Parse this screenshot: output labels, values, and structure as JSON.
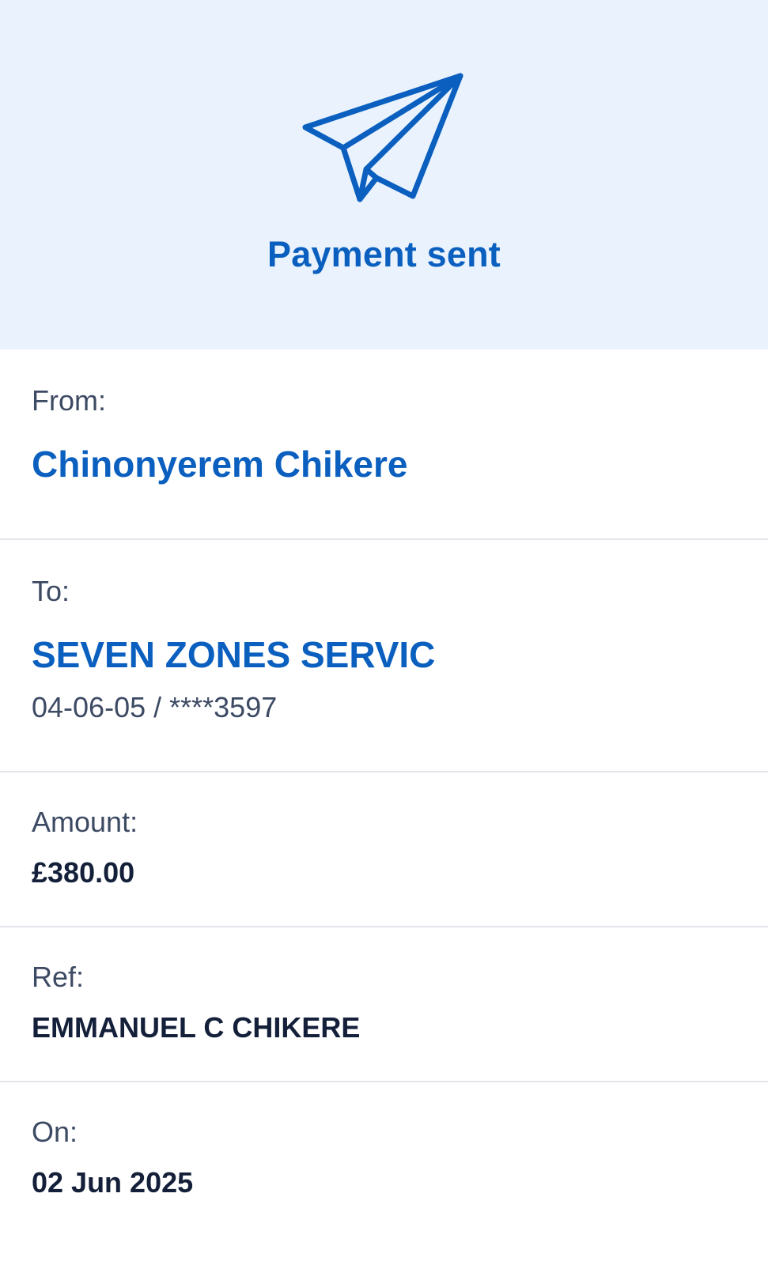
{
  "header": {
    "icon": "paper-plane-icon",
    "title": "Payment sent"
  },
  "from": {
    "label": "From:",
    "name": "Chinonyerem Chikere"
  },
  "to": {
    "label": "To:",
    "name": "SEVEN ZONES SERVIC",
    "account": "04-06-05 / ****3597"
  },
  "amount": {
    "label": "Amount:",
    "value": "£380.00"
  },
  "ref": {
    "label": "Ref:",
    "value": "EMMANUEL C CHIKERE"
  },
  "on": {
    "label": "On:",
    "value": "02 Jun 2025"
  },
  "colors": {
    "accent": "#0a5fbf",
    "header_bg": "#eaf3fd",
    "text_dark": "#14203a",
    "text_muted": "#3d4a63",
    "divider": "#e3e5ea"
  }
}
